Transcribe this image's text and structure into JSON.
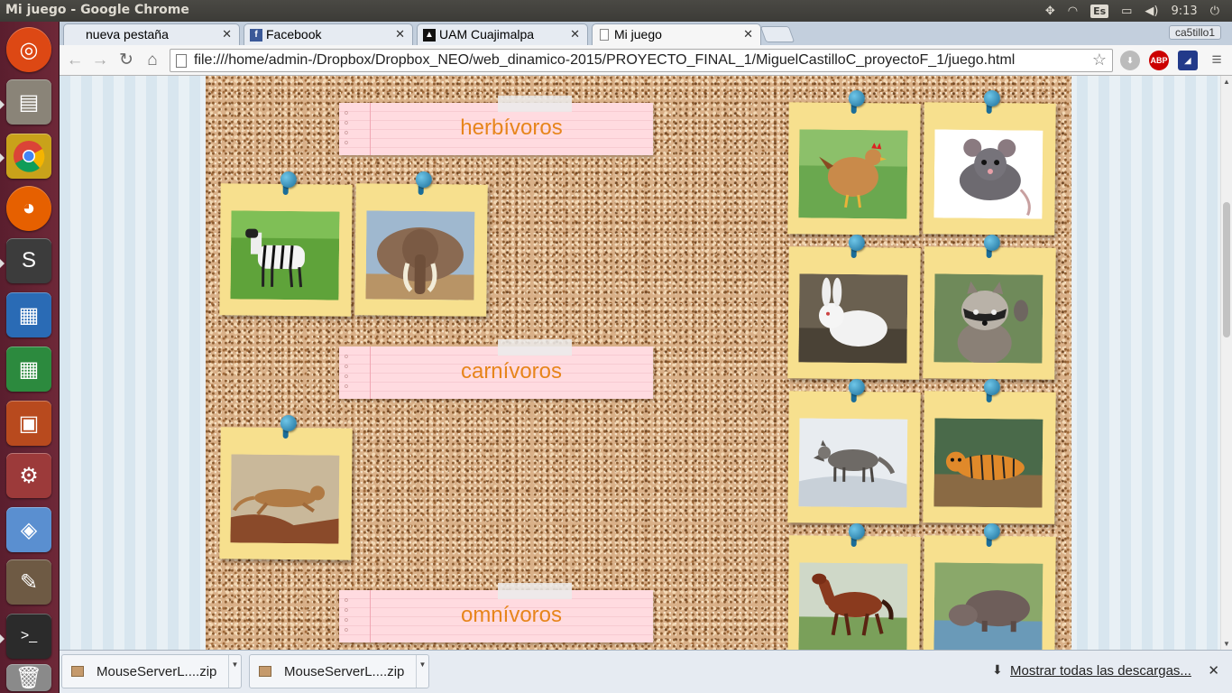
{
  "window": {
    "title": "Mi juego - Google Chrome"
  },
  "panel": {
    "keyboard": "Es",
    "time": "9:13"
  },
  "launcher": {
    "icons": [
      "ubuntu-dash-icon",
      "files-icon",
      "chrome-icon",
      "firefox-icon",
      "sublime-text-icon",
      "writer-icon",
      "calc-icon",
      "impress-icon",
      "settings-icon",
      "box-icon",
      "gimp-icon",
      "terminal-icon",
      "trash-icon"
    ]
  },
  "tabs": [
    {
      "label": "nueva pestaña",
      "icon": "blank-icon",
      "active": false
    },
    {
      "label": "Facebook",
      "icon": "facebook-icon",
      "active": false
    },
    {
      "label": "UAM Cuajimalpa",
      "icon": "uam-icon",
      "active": false
    },
    {
      "label": "Mi juego",
      "icon": "page-icon",
      "active": true
    }
  ],
  "profile": "ca5tillo1",
  "omnibox": {
    "url": "file:///home/admin-/Dropbox/Dropbox_NEO/web_dinamico-2015/PROYECTO_FINAL_1/MiguelCastilloC_proyectoF_1/juego.html"
  },
  "game": {
    "categories": [
      {
        "label": "herbívoros"
      },
      {
        "label": "carnívoros"
      },
      {
        "label": "omnívoros"
      }
    ],
    "placed": [
      {
        "animal": "zebra",
        "category": "herbívoros"
      },
      {
        "animal": "elephant",
        "category": "herbívoros"
      },
      {
        "animal": "puma",
        "category": "carnívoros"
      }
    ],
    "pool": [
      "hen",
      "rat",
      "rabbit",
      "raccoon",
      "wolf",
      "tiger",
      "horse",
      "hippopotamus"
    ]
  },
  "downloads": {
    "items": [
      {
        "name": "MouseServerL....zip"
      },
      {
        "name": "MouseServerL....zip"
      }
    ],
    "show_all": "Mostrar todas las descargas..."
  },
  "colors": {
    "label_text": "#e7851c",
    "note": "#f7e08e",
    "label_note": "#ffdbe0",
    "pin": "#1b6d98"
  }
}
